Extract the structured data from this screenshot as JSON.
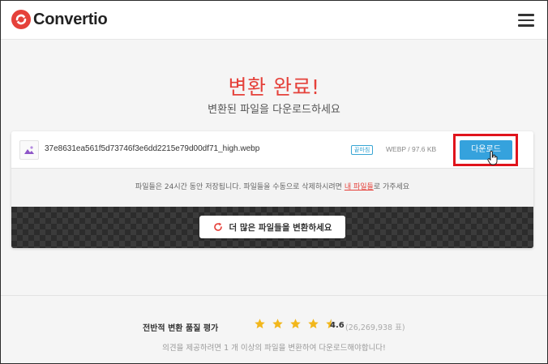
{
  "header": {
    "brand": "Convertio",
    "brand_color": "#e5413a"
  },
  "status": {
    "title": "변환 완료!",
    "subtitle": "변환된 파일을 다운로드하세요"
  },
  "file": {
    "name": "37e8631ea561f5d73746f3e6dd2215e79d00df71_high.webp",
    "badge": "끝마침",
    "meta": "WEBP / 97.6 KB",
    "download_label": "다운로드",
    "icon": "image-file-icon"
  },
  "note": {
    "prefix": "파일들은 24시간 동안 저장됩니다. 파일들을 수동으로 삭제하시려면 ",
    "link": "내 파일들",
    "suffix": "로 가주세요"
  },
  "convert_more": {
    "label": "더 많은 파일들을 변환하세요"
  },
  "rating": {
    "label": "전반적 변환 품질 평가",
    "score": "4.6",
    "stars": 4.5,
    "votes": "(26,269,938 표)",
    "note": "의견을 제공하려면 1 개 이상의 파일을 변환하여 다운로드해야합니다!"
  },
  "colors": {
    "accent_red": "#e5413a",
    "download_blue": "#35a2dd",
    "star_gold": "#f2b71c",
    "highlight_red": "#e0141c"
  }
}
